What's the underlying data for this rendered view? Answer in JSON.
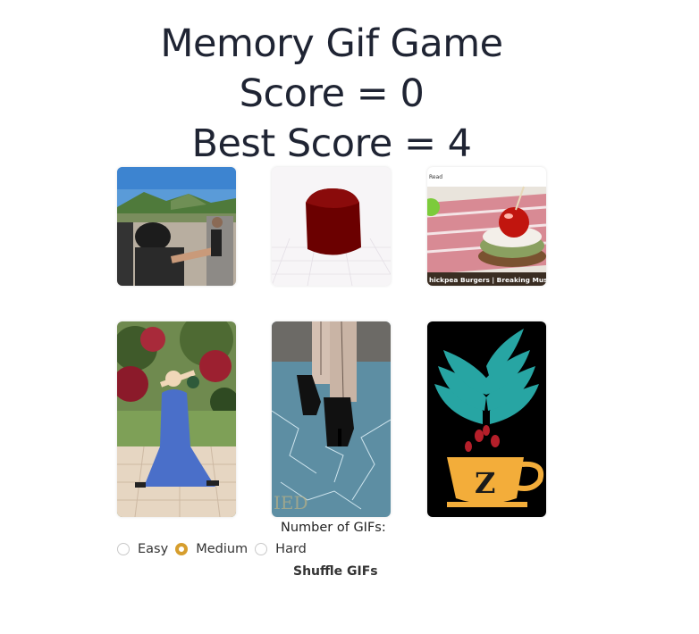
{
  "header": {
    "title": "Memory Gif Game",
    "score": "Score = 0",
    "best_score": "Best Score = 4"
  },
  "cards": [
    {
      "description": "People outdoors with mountains"
    },
    {
      "description": "Dark red 3D cube shape"
    },
    {
      "description": "Chickpea burger with cherry tomato",
      "caption": "hickpea Burgers | Breaking Muscle",
      "top_text": "Read"
    },
    {
      "description": "Person in blue dress in garden"
    },
    {
      "description": "High heels stepping on glass",
      "watermark": "IED"
    },
    {
      "description": "Coffee cup logo with letter Z",
      "letter": "Z"
    }
  ],
  "controls": {
    "number_label": "Number of GIFs:",
    "difficulty_options": [
      "Easy",
      "Medium",
      "Hard"
    ],
    "selected": "Medium",
    "shuffle_label": "Shuffle GIFs"
  },
  "colors": {
    "accent": "#d69e2e",
    "text": "#1f2433"
  }
}
